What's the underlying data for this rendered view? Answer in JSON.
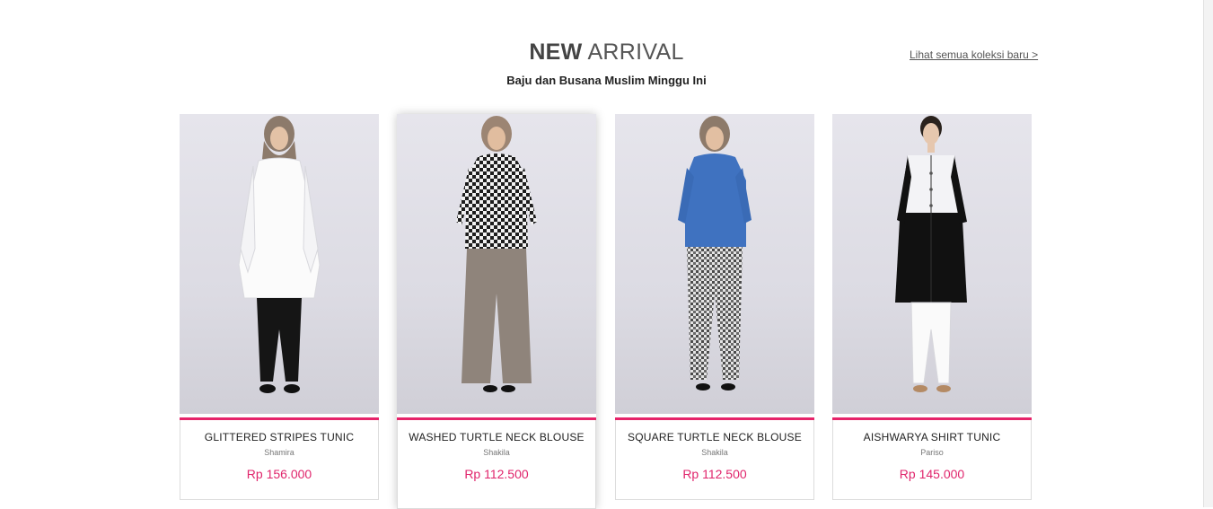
{
  "section": {
    "title_bold": "NEW",
    "title_light": "ARRIVAL",
    "subtitle": "Baju dan Busana Muslim Minggu Ini",
    "view_all": "Lihat semua koleksi baru >"
  },
  "products": [
    {
      "name": "GLITTERED STRIPES TUNIC",
      "brand": "Shamira",
      "price": "Rp 156.000"
    },
    {
      "name": "WASHED TURTLE NECK BLOUSE",
      "brand": "Shakila",
      "price": "Rp 112.500"
    },
    {
      "name": "SQUARE TURTLE NECK BLOUSE",
      "brand": "Shakila",
      "price": "Rp 112.500"
    },
    {
      "name": "AISHWARYA SHIRT TUNIC",
      "brand": "Pariso",
      "price": "Rp 145.000"
    }
  ],
  "colors": {
    "accent": "#e6246a",
    "price": "#e0256c"
  }
}
